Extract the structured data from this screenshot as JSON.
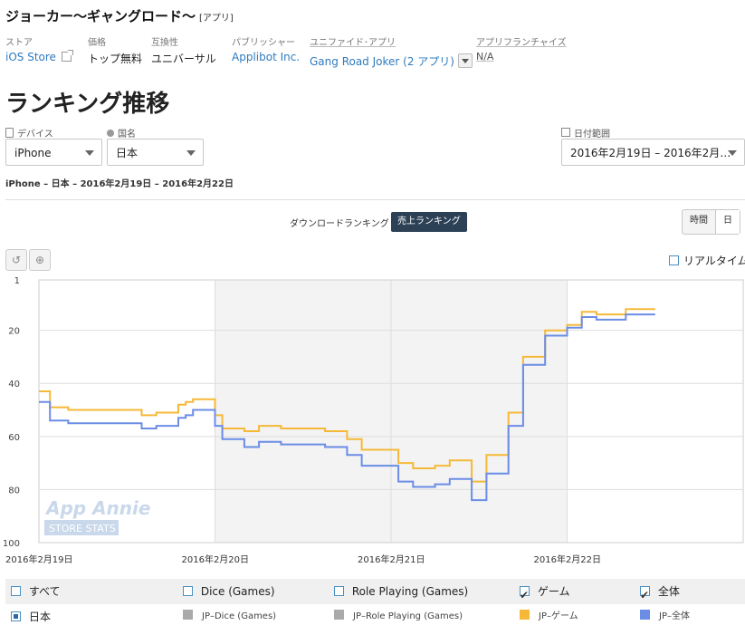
{
  "app": {
    "title": "ジョーカー〜ギャングロード〜",
    "tag": "[アプリ]"
  },
  "meta": {
    "store": {
      "label": "ストア",
      "value": "iOS Store"
    },
    "price": {
      "label": "価格",
      "value": "トップ無料"
    },
    "compat": {
      "label": "互換性",
      "value": "ユニバーサル"
    },
    "publisher": {
      "label": "パブリッシャー",
      "value": "Applibot Inc."
    },
    "unified": {
      "label": "ユニファイド･アプリ",
      "value": "Gang Road Joker (2 アプリ)"
    },
    "franchise": {
      "label": "アプリフランチャイズ",
      "value": "N/A"
    }
  },
  "section_title": "ランキング推移",
  "filters": {
    "device": {
      "label": "デバイス",
      "value": "iPhone"
    },
    "country": {
      "label": "国名",
      "value": "日本"
    },
    "date": {
      "label": "日付範囲",
      "value": "2016年2月19日 – 2016年2月…"
    }
  },
  "summary": "iPhone – 日本 – 2016年2月19日 – 2016年2月22日",
  "ranking_toggle": {
    "downloads": "ダウンロードランキング",
    "revenue": "売上ランキング"
  },
  "granularity": {
    "hour": "時間",
    "day": "日"
  },
  "tools": {
    "reset_glyph": "↺",
    "zoom_glyph": "⊕"
  },
  "realtime_label": "リアルタイム",
  "watermark": {
    "brand": "App Annie",
    "sub": "STORE STATS"
  },
  "colors": {
    "game": "#f5b937",
    "overall": "#6b8de6",
    "gray": "#aaaaaa",
    "accent": "#2d4156"
  },
  "chart_data": {
    "type": "line",
    "y_reversed": true,
    "ylim": [
      1,
      100
    ],
    "yticks": [
      "1",
      "20",
      "40",
      "60",
      "80",
      "100"
    ],
    "xlim": [
      "2016-02-19 00:00",
      "2016-02-23 00:00"
    ],
    "xticks": [
      "2016年2月19日",
      "2016年2月20日",
      "2016年2月21日",
      "2016年2月22日"
    ],
    "grid": true,
    "shaded_band": [
      "2016-02-20 00:00",
      "2016-02-22 00:00"
    ],
    "series": [
      {
        "name": "JP–ゲーム",
        "x": [
          0,
          1,
          1.5,
          2,
          3,
          4,
          5,
          6,
          7,
          8,
          9,
          10,
          11,
          12,
          13,
          14,
          15,
          16,
          17,
          18,
          19,
          20,
          21,
          22,
          23,
          24,
          25,
          26,
          27,
          28,
          29,
          30,
          31,
          32,
          33,
          34,
          35,
          36,
          37,
          38,
          39,
          40,
          41,
          42,
          43,
          44,
          45,
          46,
          47,
          48,
          49,
          50,
          51,
          52,
          53,
          54,
          55,
          56,
          57,
          58,
          59,
          60,
          61,
          62,
          63,
          64,
          65,
          66,
          67,
          68,
          69,
          70,
          71,
          72,
          73,
          74,
          75,
          76,
          77,
          78,
          79,
          80,
          81,
          82,
          83,
          84
        ],
        "y": [
          43,
          43,
          49,
          49,
          49,
          50,
          50,
          50,
          50,
          50,
          50,
          50,
          50,
          50,
          50,
          52,
          52,
          51,
          51,
          51,
          48,
          47,
          46,
          46,
          46,
          52,
          57,
          57,
          57,
          58,
          58,
          56,
          56,
          56,
          57,
          57,
          57,
          57,
          57,
          57,
          58,
          58,
          58,
          61,
          61,
          65,
          65,
          65,
          65,
          65,
          70,
          70,
          72,
          72,
          72,
          71,
          71,
          69,
          69,
          69,
          77,
          77,
          67,
          67,
          67,
          51,
          51,
          30,
          30,
          30,
          20,
          20,
          20,
          18,
          18,
          13,
          13,
          14,
          14,
          14,
          14,
          12,
          12,
          12,
          12,
          12
        ]
      },
      {
        "name": "JP–全体",
        "x": [
          0,
          1,
          1.5,
          2,
          3,
          4,
          5,
          6,
          7,
          8,
          9,
          10,
          11,
          12,
          13,
          14,
          15,
          16,
          17,
          18,
          19,
          20,
          21,
          22,
          23,
          24,
          25,
          26,
          27,
          28,
          29,
          30,
          31,
          32,
          33,
          34,
          35,
          36,
          37,
          38,
          39,
          40,
          41,
          42,
          43,
          44,
          45,
          46,
          47,
          48,
          49,
          50,
          51,
          52,
          53,
          54,
          55,
          56,
          57,
          58,
          59,
          60,
          61,
          62,
          63,
          64,
          65,
          66,
          67,
          68,
          69,
          70,
          71,
          72,
          73,
          74,
          75,
          76,
          77,
          78,
          79,
          80,
          81,
          82,
          83,
          84
        ],
        "y": [
          47,
          47,
          54,
          54,
          54,
          55,
          55,
          55,
          55,
          55,
          55,
          55,
          55,
          55,
          55,
          57,
          57,
          56,
          56,
          56,
          53,
          52,
          50,
          50,
          50,
          56,
          61,
          61,
          61,
          64,
          64,
          62,
          62,
          62,
          63,
          63,
          63,
          63,
          63,
          63,
          64,
          64,
          64,
          67,
          67,
          71,
          71,
          71,
          71,
          71,
          77,
          77,
          79,
          79,
          79,
          78,
          78,
          76,
          76,
          76,
          84,
          84,
          74,
          74,
          74,
          56,
          56,
          33,
          33,
          33,
          22,
          22,
          22,
          19,
          19,
          15,
          15,
          16,
          16,
          16,
          16,
          14,
          14,
          14,
          14,
          14
        ]
      }
    ],
    "x_unit_note": "x values are hours since 2016年2月19日 00:00"
  },
  "legend": {
    "row1": [
      {
        "label": "すべて",
        "checked": false
      },
      {
        "label": "Dice (Games)",
        "checked": false
      },
      {
        "label": "Role Playing (Games)",
        "checked": false
      },
      {
        "label": "ゲーム",
        "checked": true
      },
      {
        "label": "全体",
        "checked": true
      }
    ],
    "row2": [
      {
        "label": "日本"
      },
      {
        "label": "JP–Dice (Games)"
      },
      {
        "label": "JP–Role Playing (Games)"
      },
      {
        "label": "JP–ゲーム"
      },
      {
        "label": "JP–全体"
      }
    ]
  }
}
